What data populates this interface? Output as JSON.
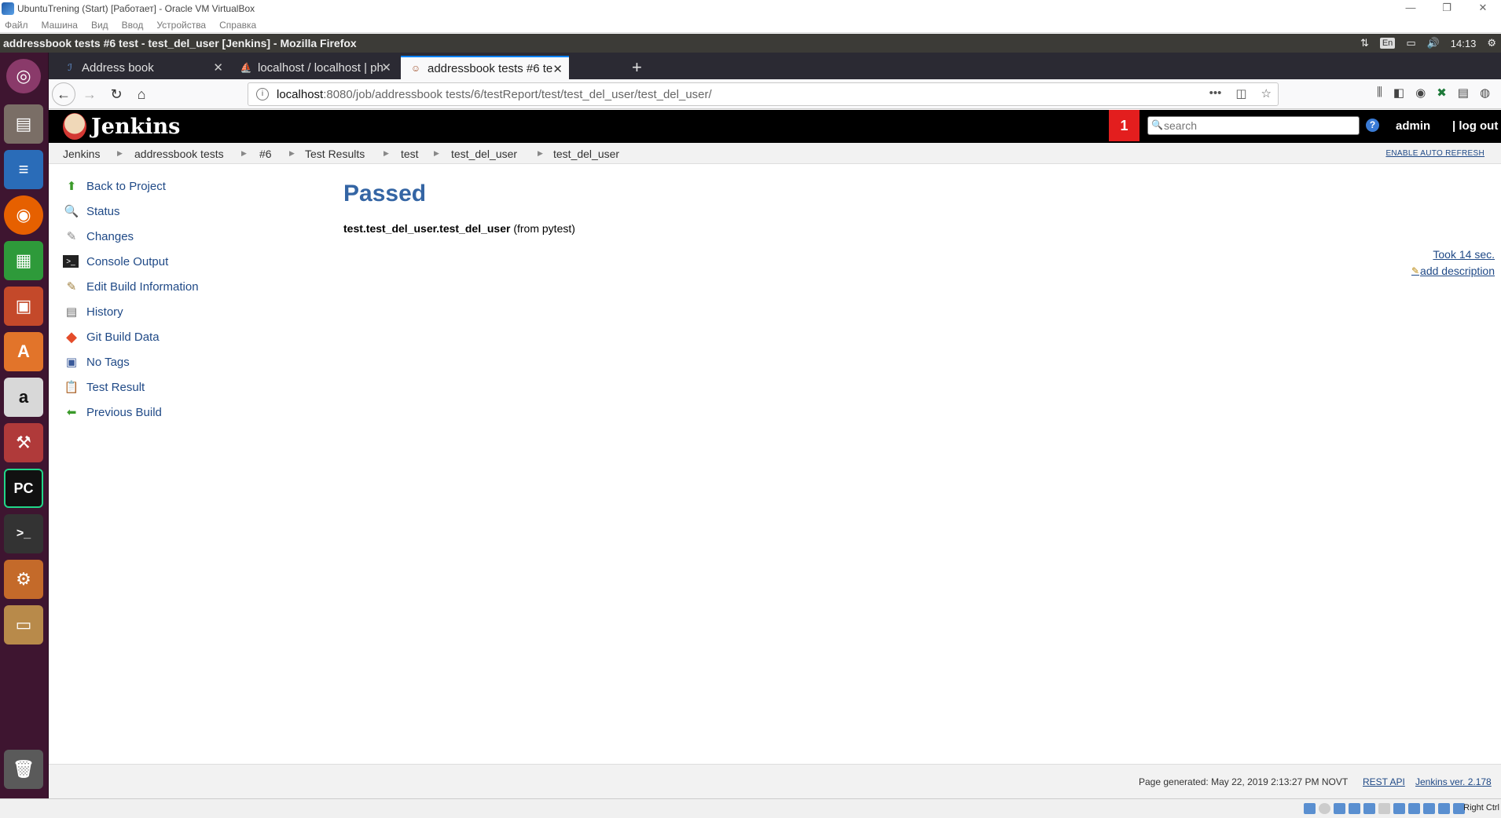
{
  "vbox": {
    "title": "UbuntuTrening (Start) [Работает] - Oracle VM VirtualBox",
    "menu": [
      "Файл",
      "Машина",
      "Вид",
      "Ввод",
      "Устройства",
      "Справка"
    ],
    "window_controls": [
      "—",
      "❐",
      "✕"
    ],
    "host_key": "Right Ctrl"
  },
  "ubuntu": {
    "window_title": "addressbook tests #6 test - test_del_user [Jenkins] - Mozilla Firefox",
    "language": "En",
    "time": "14:13"
  },
  "launcher": {
    "items": [
      "ubuntu-dash-icon",
      "files-icon",
      "writer-icon",
      "firefox-icon",
      "calc-icon",
      "impress-icon",
      "software-center-icon",
      "amazon-icon",
      "system-settings-icon",
      "pycharm-icon",
      "terminal-icon",
      "settings-tool-icon",
      "archive-icon",
      "trash-icon"
    ]
  },
  "browser": {
    "tabs": [
      {
        "label": "Address book",
        "active": false
      },
      {
        "label": "localhost / localhost | ph",
        "active": false
      },
      {
        "label": "addressbook tests #6 te",
        "active": true
      }
    ],
    "url_host": "localhost",
    "url_path": ":8080/job/addressbook tests/6/testReport/test/test_del_user/test_del_user/"
  },
  "jenkins": {
    "logo_text": "Jenkins",
    "notification_count": "1",
    "search_placeholder": "search",
    "user": "admin",
    "logout": "| log out",
    "breadcrumbs": [
      "Jenkins",
      "addressbook tests",
      "#6",
      "Test Results",
      "test",
      "test_del_user",
      "test_del_user"
    ],
    "auto_refresh": "ENABLE AUTO REFRESH",
    "tasks": [
      {
        "label": "Back to Project",
        "icon": "up-arrow-icon"
      },
      {
        "label": "Status",
        "icon": "magnifier-icon"
      },
      {
        "label": "Changes",
        "icon": "notepad-icon"
      },
      {
        "label": "Console Output",
        "icon": "terminal-icon"
      },
      {
        "label": "Edit Build Information",
        "icon": "edit-icon"
      },
      {
        "label": "History",
        "icon": "history-icon"
      },
      {
        "label": "Git Build Data",
        "icon": "git-icon"
      },
      {
        "label": "No Tags",
        "icon": "save-icon"
      },
      {
        "label": "Test Result",
        "icon": "clipboard-icon"
      },
      {
        "label": "Previous Build",
        "icon": "left-arrow-icon"
      }
    ],
    "result_title": "Passed",
    "test_full_name": "test.test_del_user.test_del_user",
    "test_source": "(from pytest)",
    "duration": "Took 14 sec.",
    "add_description": "add description",
    "footer": {
      "generated": "Page generated: May 22, 2019 2:13:27 PM NOVT",
      "rest_api": "REST API",
      "version": "Jenkins ver. 2.178"
    }
  },
  "colors": {
    "link": "#204a87",
    "passed_title": "#3465a4",
    "header_bg": "#000000",
    "notification": "#e31e1e",
    "launcher_bg": "#3e1530"
  }
}
